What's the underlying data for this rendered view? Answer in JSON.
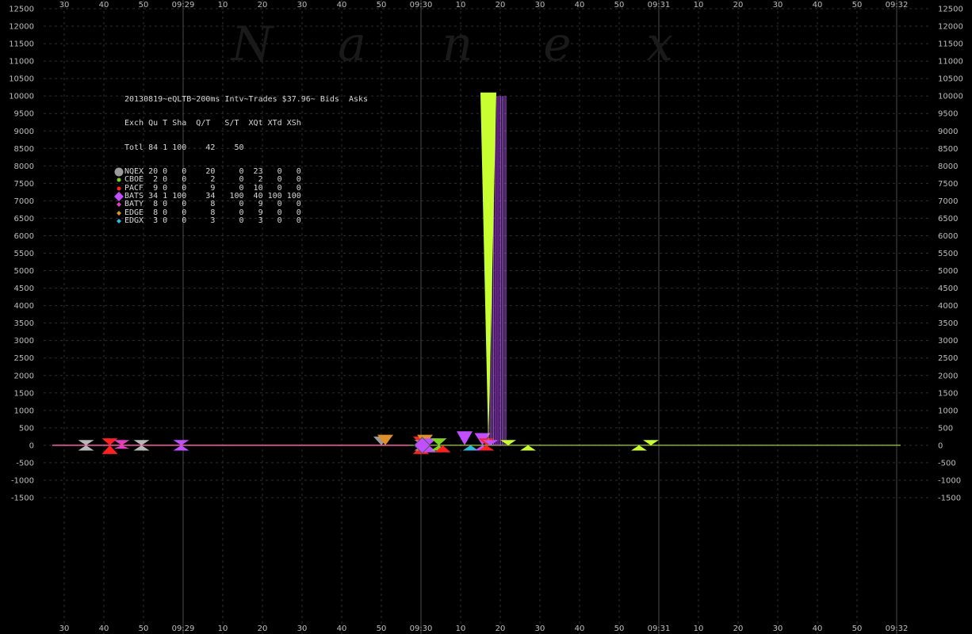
{
  "watermark": [
    "N",
    "a",
    "n",
    "e",
    "x"
  ],
  "legend": {
    "title": "20130819~eQLTB~200ms Intv~Trades $37.96~ Bids  Asks",
    "header": "Exch Qu T Sha  Q/T   S/T  XQt XTd XSh",
    "total": "Totl 84 1 100    42    50",
    "rows": [
      {
        "exchange": "NQEX",
        "text": "NQEX 20 0   0    20     0  23   0   0",
        "color": "#9a9a9a",
        "marker": "circle-large"
      },
      {
        "exchange": "CBOE",
        "text": "CBOE  2 0   0     2     0   2   0   0",
        "color": "#7ed321",
        "marker": "circle"
      },
      {
        "exchange": "PACF",
        "text": "PACF  9 0   0     9     0  10   0   0",
        "color": "#ff2020",
        "marker": "circle"
      },
      {
        "exchange": "BATS",
        "text": "BATS 34 1 100    34   100  40 100 100",
        "color": "#c050ff",
        "marker": "diamond-large"
      },
      {
        "exchange": "BATY",
        "text": "BATY  8 0   0     8     0   9   0   0",
        "color": "#e040c0",
        "marker": "diamond"
      },
      {
        "exchange": "EDGE",
        "text": "EDGE  8 0   0     8     0   9   0   0",
        "color": "#e0902a",
        "marker": "diamond"
      },
      {
        "exchange": "EDGX",
        "text": "EDGX  3 0   0     3     0   3   0   0",
        "color": "#30b8d8",
        "marker": "diamond"
      }
    ]
  },
  "chart_data": {
    "type": "scatter",
    "x_unit": "seconds after 09:28:00",
    "x_range": [
      25,
      242
    ],
    "x_tick_labels": [
      {
        "t": 30,
        "label": "30"
      },
      {
        "t": 40,
        "label": "40"
      },
      {
        "t": 50,
        "label": "50"
      },
      {
        "t": 60,
        "label": "09:29"
      },
      {
        "t": 70,
        "label": "10"
      },
      {
        "t": 80,
        "label": "20"
      },
      {
        "t": 90,
        "label": "30"
      },
      {
        "t": 100,
        "label": "40"
      },
      {
        "t": 110,
        "label": "50"
      },
      {
        "t": 120,
        "label": "09:30"
      },
      {
        "t": 130,
        "label": "10"
      },
      {
        "t": 140,
        "label": "20"
      },
      {
        "t": 150,
        "label": "30"
      },
      {
        "t": 160,
        "label": "40"
      },
      {
        "t": 170,
        "label": "50"
      },
      {
        "t": 180,
        "label": "09:31"
      },
      {
        "t": 190,
        "label": "10"
      },
      {
        "t": 200,
        "label": "20"
      },
      {
        "t": 210,
        "label": "30"
      },
      {
        "t": 220,
        "label": "40"
      },
      {
        "t": 230,
        "label": "50"
      },
      {
        "t": 240,
        "label": "09:32"
      }
    ],
    "y_range": [
      -1500,
      12500
    ],
    "y_ticks": [
      12500,
      12000,
      11500,
      11000,
      10500,
      10000,
      9500,
      9000,
      8500,
      8000,
      7500,
      7000,
      6500,
      6000,
      5500,
      5000,
      4500,
      4000,
      3500,
      3000,
      2500,
      2000,
      1500,
      1000,
      500,
      0,
      -500,
      -1000,
      -1500
    ],
    "grid": true,
    "bid_ask_markers": [
      {
        "t": 35.5,
        "bid": 150,
        "ask": -150,
        "color": "#b8b8b8"
      },
      {
        "t": 41.5,
        "bid": 200,
        "ask": -250,
        "color": "#ff2020"
      },
      {
        "t": 44.5,
        "bid": 150,
        "ask": -100,
        "color": "#e040c0"
      },
      {
        "t": 49.5,
        "bid": 150,
        "ask": -150,
        "color": "#b8b8b8"
      },
      {
        "t": 59.5,
        "bid": 150,
        "ask": -150,
        "color": "#c050ff"
      },
      {
        "t": 110,
        "bid": 250,
        "ask": 0,
        "color": "#9a9a9a"
      },
      {
        "t": 111,
        "bid": 300,
        "ask": 0,
        "color": "#e0902a"
      },
      {
        "t": 120,
        "bid": 250,
        "ask": -250,
        "color": "#ff2020"
      },
      {
        "t": 120.3,
        "bid": 150,
        "ask": -150,
        "color": "#9a9a9a"
      },
      {
        "t": 121,
        "bid": 300,
        "ask": 0,
        "color": "#e0902a"
      },
      {
        "t": 122,
        "bid": 200,
        "ask": -200,
        "color": "#c050ff"
      },
      {
        "t": 124.5,
        "bid": 200,
        "ask": -150,
        "color": "#7ed321"
      },
      {
        "t": 125.5,
        "bid": 0,
        "ask": -200,
        "color": "#ff2020"
      },
      {
        "t": 131,
        "bid": 400,
        "ask": 0,
        "color": "#c050ff"
      },
      {
        "t": 132.5,
        "bid": 0,
        "ask": -150,
        "color": "#30b8d8"
      },
      {
        "t": 135.5,
        "bid": 350,
        "ask": -150,
        "color": "#c050ff"
      },
      {
        "t": 136.5,
        "bid": 200,
        "ask": -150,
        "color": "#ff2020"
      },
      {
        "t": 137.5,
        "bid": 150,
        "ask": 0,
        "color": "#c050ff"
      },
      {
        "t": 137,
        "bid": 10100,
        "ask": 0,
        "color": "#c8ff30"
      },
      {
        "t": 142,
        "bid": 150,
        "ask": 0,
        "color": "#c8ff30"
      },
      {
        "t": 147,
        "bid": 0,
        "ask": -150,
        "color": "#c8ff30"
      },
      {
        "t": 175,
        "bid": 0,
        "ask": -150,
        "color": "#c8ff30"
      },
      {
        "t": 178,
        "bid": 150,
        "ask": 0,
        "color": "#c8ff30"
      }
    ],
    "diamond_marker": {
      "t": 120.3,
      "value": 0,
      "color": "#c050ff"
    },
    "bats_bid_size_bars": {
      "t_start": 137,
      "t_end": 141.5,
      "value": 10000,
      "color": "#c050ff"
    },
    "baseline": {
      "t_start": 27,
      "t_end": 241,
      "value": 0,
      "color_left": "#ff5aa8",
      "color_right": "#c8ff30"
    }
  }
}
